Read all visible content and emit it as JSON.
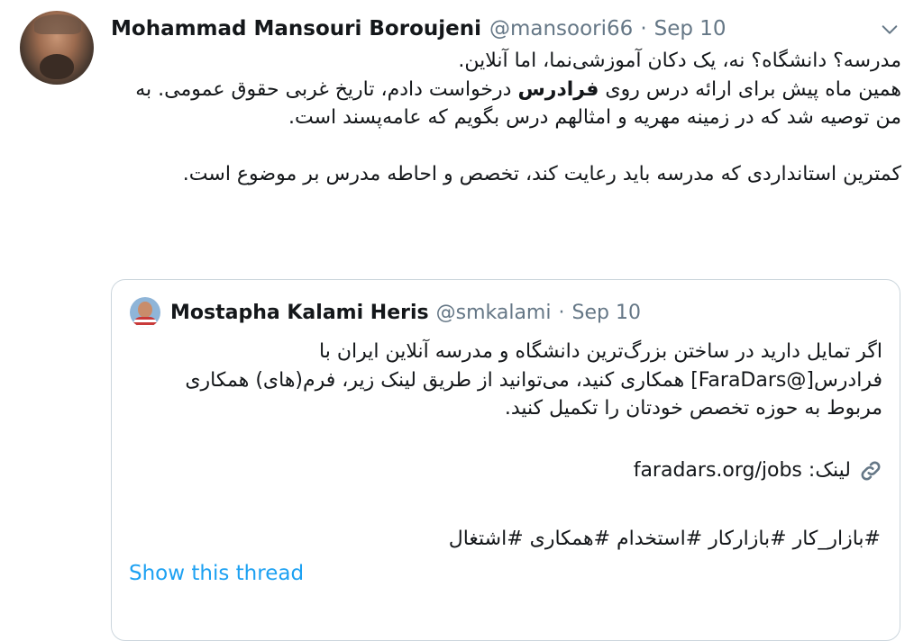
{
  "tweet": {
    "author_name": "Mohammad Mansouri Boroujeni",
    "handle": "@mansoori66",
    "separator": "·",
    "date": "Sep 10",
    "line1": "مدرسه؟ دانشگاه؟ نه، یک دکان آموزشی‌نما، اما آنلاین.",
    "line2_before": "همین ماه پیش برای ارائه درس روی ",
    "line2_brand": "فرادرس",
    "line2_after": " درخواست دادم، تاریخ غربی حقوق عمومی. به من توصیه شد که در زمینه مهریه و امثالهم درس بگویم که عامه‌پسند است.",
    "line3": "کمترین استانداردی که مدرسه باید رعایت کند، تخصص و احاطه مدرس بر موضوع است."
  },
  "quoted": {
    "author_name": "Mostapha Kalami Heris",
    "handle": "@smkalami",
    "separator": "·",
    "date": "Sep 10",
    "text": "اگر تمایل دارید در ساختن بزرگ‌ترین دانشگاه و مدرسه آنلاین ایران با فرادرس[@FaraDars] همکاری کنید، می‌توانید از طریق لینک زیر، فرم(های) همکاری مربوط به حوزه تخصص خودتان را تکمیل کنید.",
    "link_label": "لینک:",
    "link_url": "faradars.org/jobs",
    "hashtags": "#بازار_کار #بازارکار #استخدام #همکاری #اشتغال"
  },
  "show_thread": "Show this thread",
  "icons": {
    "menu": "chevron-down-icon",
    "link": "link-icon"
  },
  "colors": {
    "accent": "#1da1f2",
    "muted": "#657786",
    "border": "#ccd6dd"
  }
}
